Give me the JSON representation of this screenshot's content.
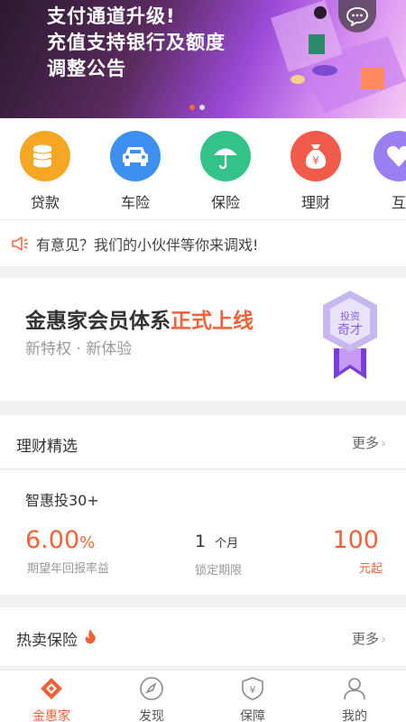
{
  "banner": {
    "lines": [
      "支付通道升级!",
      "充值支持银行及额度",
      "调整公告"
    ],
    "dots": 2,
    "active_dot": 0
  },
  "quick_nav": [
    {
      "label": "贷款",
      "icon": "coins-icon",
      "color": "#f5a623"
    },
    {
      "label": "车险",
      "icon": "car-icon",
      "color": "#3d8ff0"
    },
    {
      "label": "保险",
      "icon": "umbrella-icon",
      "color": "#33c28a"
    },
    {
      "label": "理财",
      "icon": "money-bag-icon",
      "color": "#f25a4a"
    },
    {
      "label": "互",
      "icon": "heart-icon",
      "color": "#9b7ef2"
    }
  ],
  "notice": {
    "text": "有意见？我们的小伙伴等你来调戏!"
  },
  "member": {
    "title_main": "金惠家会员体系",
    "title_highlight": "正式上线",
    "subtitle": "新特权 · 新体验",
    "badge_line1": "投资",
    "badge_line2": "奇才"
  },
  "finance": {
    "section_title": "理财精选",
    "more": "更多",
    "product": {
      "name": "智惠投30+",
      "rate_value": "6.00",
      "rate_unit": "%",
      "rate_label": "期望年回报率益",
      "period_value": "1",
      "period_unit": "个月",
      "period_label": "锁定期限",
      "min_value": "100",
      "min_label": "元起"
    }
  },
  "insurance": {
    "section_title": "热卖保险",
    "more": "更多"
  },
  "tabbar": [
    {
      "label": "金惠家",
      "icon": "home-logo-icon",
      "active": true
    },
    {
      "label": "发现",
      "icon": "compass-icon",
      "active": false
    },
    {
      "label": "保障",
      "icon": "shield-yen-icon",
      "active": false
    },
    {
      "label": "我的",
      "icon": "user-icon",
      "active": false
    }
  ],
  "colors": {
    "accent": "#f0623a"
  }
}
